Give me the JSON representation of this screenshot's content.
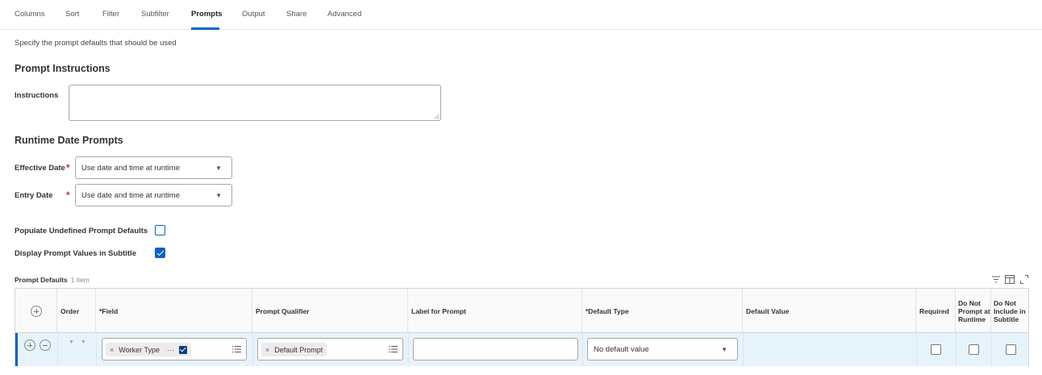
{
  "tabs": [
    {
      "label": "Columns",
      "active": false
    },
    {
      "label": "Sort",
      "active": false
    },
    {
      "label": "Filter",
      "active": false
    },
    {
      "label": "Subfilter",
      "active": false
    },
    {
      "label": "Prompts",
      "active": true
    },
    {
      "label": "Output",
      "active": false
    },
    {
      "label": "Share",
      "active": false
    },
    {
      "label": "Advanced",
      "active": false
    }
  ],
  "description": "Specify the prompt defaults that should be used",
  "prompt_instructions": {
    "title": "Prompt Instructions",
    "instructions_label": "Instructions",
    "instructions_value": ""
  },
  "runtime_date_prompts": {
    "title": "Runtime Date Prompts",
    "effective_date": {
      "label": "Effective Date",
      "required_mark": "*",
      "value": "Use date and time at runtime"
    },
    "entry_date": {
      "label": "Entry Date",
      "required_mark": "*",
      "value": "Use date and time at runtime"
    }
  },
  "options": {
    "populate_undefined": {
      "label": "Populate Undefined Prompt Defaults",
      "checked": false
    },
    "display_in_subtitle": {
      "label": "Display Prompt Values in Subtitle",
      "checked": true
    }
  },
  "grid": {
    "title": "Prompt Defaults",
    "count": "1 item",
    "tools": [
      "filter-icon",
      "column-layout-icon",
      "expand-icon"
    ],
    "columns": {
      "order": "Order",
      "field": "*Field",
      "prompt_qualifier": "Prompt Qualifier",
      "label_for_prompt": "Label for Prompt",
      "default_type": "*Default Type",
      "default_value": "Default Value",
      "required": "Required",
      "do_not_prompt": [
        "Do Not",
        "Prompt at",
        "Runtime"
      ],
      "do_not_include": [
        "Do Not",
        "Include in",
        "Subtitle"
      ]
    },
    "rows": [
      {
        "order_arrows": "▼ ▼",
        "field": "Worker Type",
        "field_more": "···",
        "prompt_qualifier": "Default Prompt",
        "label_for_prompt": "",
        "default_type": "No default value",
        "default_value": "",
        "required": false,
        "do_not_prompt": false,
        "do_not_include": false
      }
    ]
  },
  "colors": {
    "accent": "#0b63c5",
    "required": "#d8283a",
    "row_highlight": "#e6f3fb"
  },
  "glyphs": {
    "remove": "×",
    "caret": "▼"
  }
}
